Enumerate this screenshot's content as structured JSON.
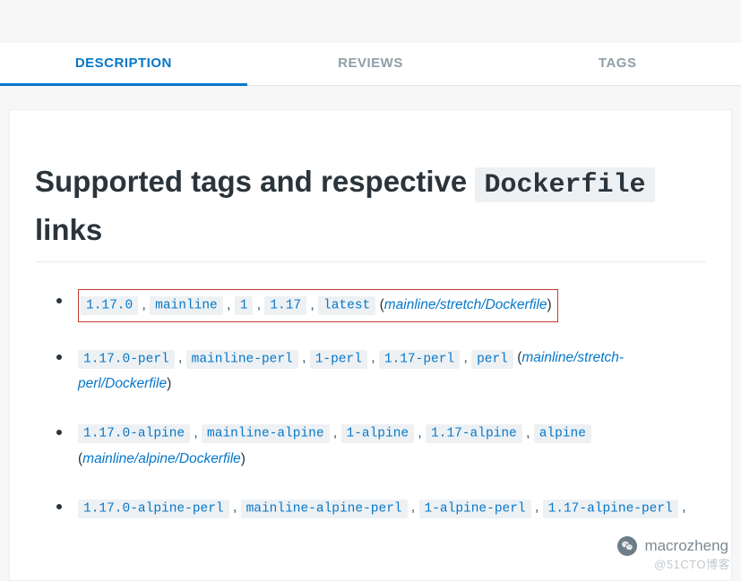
{
  "tabs": {
    "description": "DESCRIPTION",
    "reviews": "REVIEWS",
    "tags": "TAGS"
  },
  "heading": {
    "pre": "Supported tags and respective ",
    "code": "Dockerfile",
    "post": " links"
  },
  "rows": [
    {
      "highlight": true,
      "tags": [
        "1.17.0",
        "mainline",
        "1",
        "1.17",
        "latest"
      ],
      "dockerfile": "mainline/stretch/Dockerfile"
    },
    {
      "highlight": false,
      "tags": [
        "1.17.0-perl",
        "mainline-perl",
        "1-perl",
        "1.17-perl",
        "perl"
      ],
      "dockerfile": "mainline/stretch-perl/Dockerfile"
    },
    {
      "highlight": false,
      "tags": [
        "1.17.0-alpine",
        "mainline-alpine",
        "1-alpine",
        "1.17-alpine",
        "alpine"
      ],
      "dockerfile": "mainline/alpine/Dockerfile"
    },
    {
      "highlight": false,
      "tags": [
        "1.17.0-alpine-perl",
        "mainline-alpine-perl",
        "1-alpine-perl",
        "1.17-alpine-perl"
      ],
      "dockerfile": ""
    }
  ],
  "watermark": {
    "handle": "macrozheng",
    "site": "@51CTO博客"
  }
}
